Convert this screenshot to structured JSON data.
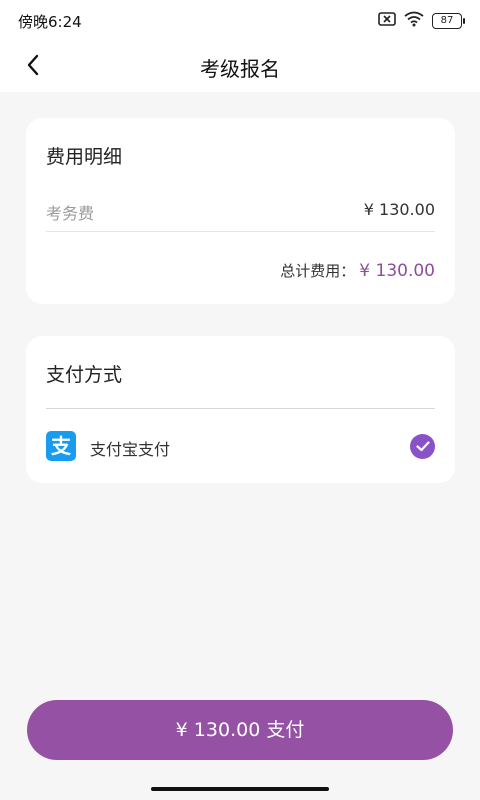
{
  "status_bar": {
    "time": "傍晚6:24",
    "battery": "87"
  },
  "header": {
    "title": "考级报名"
  },
  "fee_card": {
    "title": "费用明细",
    "items": [
      {
        "label": "考务费",
        "value": "¥ 130.00"
      }
    ],
    "total_label": "总计费用：",
    "total_value": "¥ 130.00"
  },
  "payment_card": {
    "title": "支付方式",
    "options": [
      {
        "icon": "alipay-icon",
        "icon_glyph": "支",
        "label": "支付宝支付",
        "selected": true
      }
    ]
  },
  "footer": {
    "pay_button_label": "¥ 130.00  支付"
  },
  "colors": {
    "accent": "#9552a4",
    "check": "#8a52c8",
    "alipay": "#1a9cee",
    "background": "#f6f6f6"
  }
}
